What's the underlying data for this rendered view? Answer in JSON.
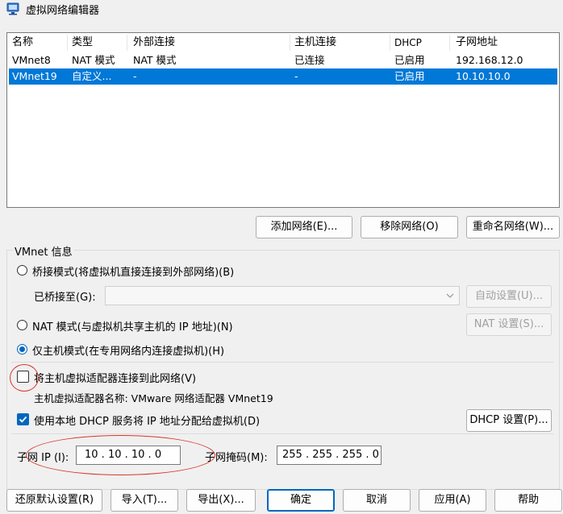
{
  "window": {
    "title": "虚拟网络编辑器",
    "icon": "network-editor-icon"
  },
  "list": {
    "headers": [
      "名称",
      "类型",
      "外部连接",
      "主机连接",
      "DHCP",
      "子网地址"
    ],
    "rows": [
      {
        "name": "VMnet8",
        "type": "NAT 模式",
        "external": "NAT 模式",
        "host": "已连接",
        "dhcp": "已启用",
        "subnet": "192.168.12.0",
        "selected": false
      },
      {
        "name": "VMnet19",
        "type": "自定义...",
        "external": "-",
        "host": "-",
        "dhcp": "已启用",
        "subnet": "10.10.10.0",
        "selected": true
      }
    ]
  },
  "list_buttons": {
    "add": "添加网络(E)...",
    "remove": "移除网络(O)",
    "rename": "重命名网络(W)..."
  },
  "vmnet_info": {
    "title": "VMnet 信息",
    "bridged_label": "桥接模式(将虚拟机直接连接到外部网络)(B)",
    "bridged_to_label": "已桥接至(G):",
    "bridged_to_value": "",
    "auto_settings": "自动设置(U)...",
    "nat_label": "NAT 模式(与虚拟机共享主机的 IP 地址)(N)",
    "nat_settings": "NAT 设置(S)...",
    "hostonly_label": "仅主机模式(在专用网络内连接虚拟机)(H)",
    "selected_mode": "hostonly",
    "connect_adapter_label": "将主机虚拟适配器连接到此网络(V)",
    "connect_adapter_checked": false,
    "adapter_name_text": "主机虚拟适配器名称: VMware 网络适配器 VMnet19",
    "dhcp_label": "使用本地 DHCP 服务将 IP 地址分配给虚拟机(D)",
    "dhcp_checked": true,
    "dhcp_settings": "DHCP 设置(P)...",
    "subnet_ip_label": "子网 IP (I):",
    "subnet_ip_value": "10 . 10 . 10 . 0",
    "subnet_mask_label": "子网掩码(M):",
    "subnet_mask_value": "255 . 255 . 255 . 0"
  },
  "footer": {
    "restore": "还原默认设置(R)",
    "import": "导入(T)...",
    "export": "导出(X)...",
    "ok": "确定",
    "cancel": "取消",
    "apply": "应用(A)",
    "help": "帮助"
  },
  "annotation_color": "#d9362a",
  "accent_color": "#0078d7"
}
